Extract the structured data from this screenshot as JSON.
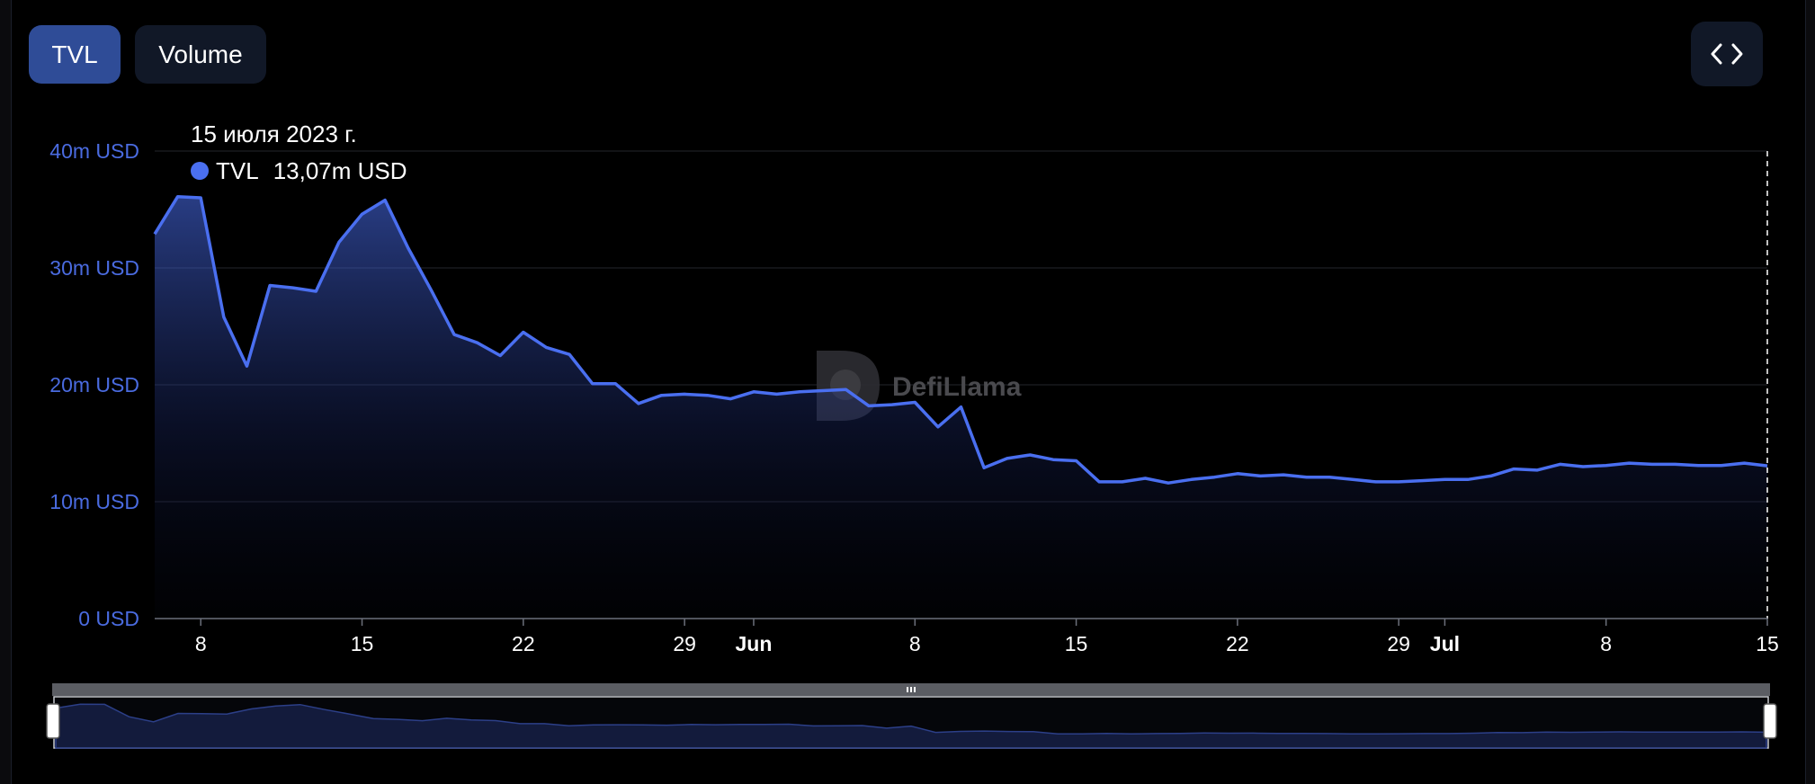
{
  "tabs": [
    {
      "label": "TVL",
      "active": true
    },
    {
      "label": "Volume",
      "active": false
    }
  ],
  "embed_icon": "code-brackets-icon",
  "tooltip": {
    "date": "15 июля 2023 г.",
    "series": "TVL",
    "value": "13,07m USD"
  },
  "watermark": "DefiLlama",
  "colors": {
    "line": "#4a6ff0",
    "active_tab": "#2f4c97",
    "axis_label": "#4a6be0",
    "background": "#000000"
  },
  "chart_data": {
    "type": "area",
    "series": [
      {
        "name": "TVL",
        "unit": "m USD",
        "values": [
          32.9,
          36.1,
          36.0,
          25.8,
          21.6,
          28.5,
          28.3,
          28.0,
          32.2,
          34.6,
          35.8,
          31.7,
          28.1,
          24.3,
          23.6,
          22.5,
          24.5,
          23.2,
          22.6,
          20.1,
          20.1,
          18.4,
          19.1,
          19.2,
          19.1,
          18.8,
          19.4,
          19.2,
          19.4,
          19.5,
          19.6,
          18.2,
          18.3,
          18.5,
          16.4,
          18.1,
          12.9,
          13.7,
          14.0,
          13.6,
          13.5,
          11.7,
          11.7,
          12.0,
          11.6,
          11.9,
          12.1,
          12.4,
          12.2,
          12.3,
          12.1,
          12.1,
          11.9,
          11.7,
          11.7,
          11.8,
          11.9,
          11.9,
          12.2,
          12.8,
          12.7,
          13.2,
          13.0,
          13.1,
          13.3,
          13.2,
          13.2,
          13.1,
          13.1,
          13.3,
          13.07
        ]
      }
    ],
    "x_start": "2023-05-06",
    "x_end": "2023-07-15",
    "x_ticks": [
      {
        "date": "2023-05-08",
        "label": "8",
        "bold": false
      },
      {
        "date": "2023-05-15",
        "label": "15",
        "bold": false
      },
      {
        "date": "2023-05-22",
        "label": "22",
        "bold": false
      },
      {
        "date": "2023-05-29",
        "label": "29",
        "bold": false
      },
      {
        "date": "2023-06-01",
        "label": "Jun",
        "bold": true
      },
      {
        "date": "2023-06-08",
        "label": "8",
        "bold": false
      },
      {
        "date": "2023-06-15",
        "label": "15",
        "bold": false
      },
      {
        "date": "2023-06-22",
        "label": "22",
        "bold": false
      },
      {
        "date": "2023-06-29",
        "label": "29",
        "bold": false
      },
      {
        "date": "2023-07-01",
        "label": "Jul",
        "bold": true
      },
      {
        "date": "2023-07-08",
        "label": "8",
        "bold": false
      },
      {
        "date": "2023-07-15",
        "label": "15",
        "bold": false
      }
    ],
    "y_ticks": [
      {
        "value": 0,
        "label": "0 USD"
      },
      {
        "value": 10,
        "label": "10m USD"
      },
      {
        "value": 20,
        "label": "20m USD"
      },
      {
        "value": 30,
        "label": "30m USD"
      },
      {
        "value": 40,
        "label": "40m USD"
      }
    ],
    "ylim": [
      0,
      40
    ],
    "grid": true,
    "cursor_date": "2023-07-15"
  }
}
